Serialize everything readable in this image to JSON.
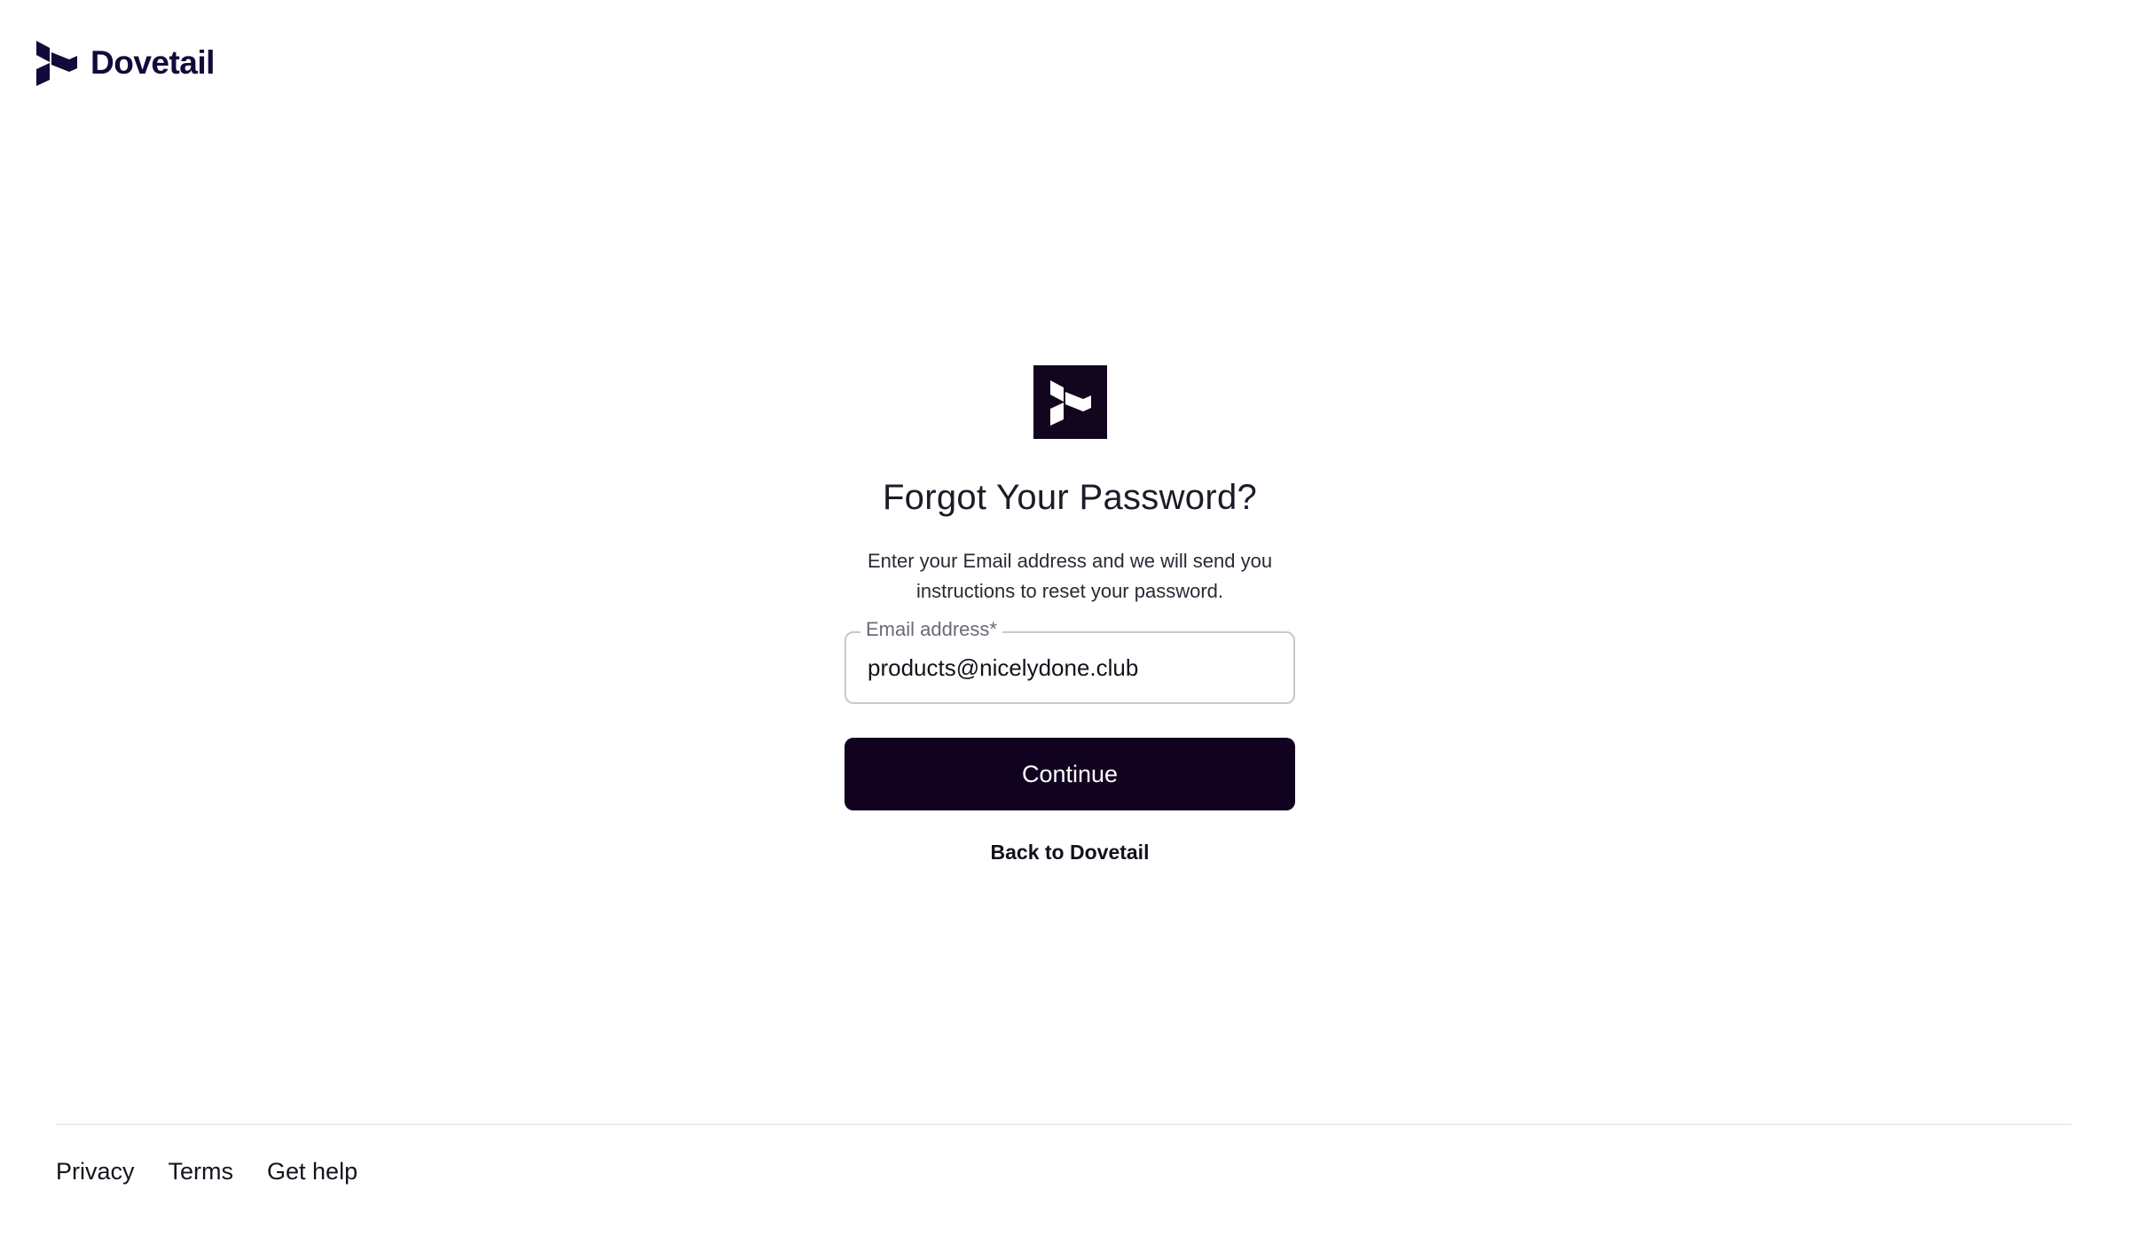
{
  "header": {
    "brand_name": "Dovetail",
    "brand_icon": "dovetail-logo-icon"
  },
  "form": {
    "logo_icon": "dovetail-logo-icon",
    "title": "Forgot Your Password?",
    "description": "Enter your Email address and we will send you instructions to reset your password.",
    "email_label": "Email address*",
    "email_value": "products@nicelydone.club",
    "continue_label": "Continue",
    "back_label": "Back to Dovetail"
  },
  "footer": {
    "links": [
      {
        "label": "Privacy"
      },
      {
        "label": "Terms"
      },
      {
        "label": "Get help"
      }
    ]
  },
  "colors": {
    "brand_dark": "#11031f",
    "brand_text": "#13093a",
    "border": "#c9c7cf"
  }
}
